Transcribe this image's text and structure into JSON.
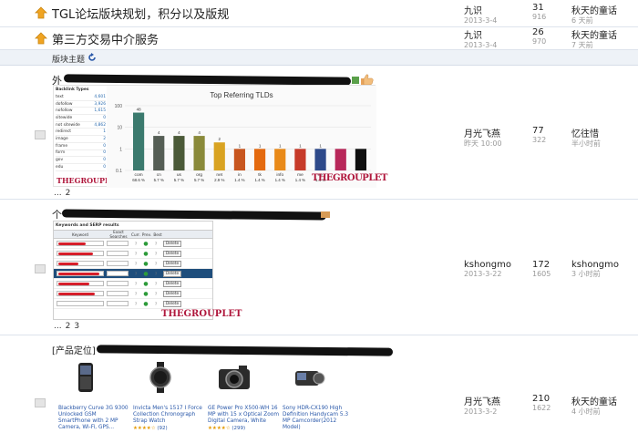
{
  "pinned": [
    {
      "title": "TGL论坛版块规划，积分以及版规",
      "author": "九识",
      "date": "2013-3-4",
      "replies": "31",
      "views": "916",
      "last_user": "秋天的童话",
      "last_time": "6 天前"
    },
    {
      "title": "第三方交易中介服务",
      "author": "九识",
      "date": "2013-3-4",
      "replies": "26",
      "views": "970",
      "last_user": "秋天的童话",
      "last_time": "7 天前"
    }
  ],
  "section": {
    "label": "版块主题"
  },
  "threads": [
    {
      "title_prefix": "外",
      "author": "月光飞燕",
      "date": "昨天 10:00",
      "replies": "77",
      "views": "322",
      "last_user": "忆往惜",
      "last_time": "半小时前",
      "pages": [
        "...",
        "2"
      ]
    },
    {
      "title_prefix": "个",
      "author": "kshongmo",
      "date": "2013-3-22",
      "replies": "172",
      "views": "1605",
      "last_user": "kshongmo",
      "last_time": "3 小时前",
      "pages": [
        "...",
        "2",
        "3"
      ]
    },
    {
      "title_prefix": "[产品定位]",
      "author": "月光飞燕",
      "date": "2013-3-2",
      "replies": "210",
      "views": "1622",
      "last_user": "秋天的童话",
      "last_time": "4 小时前"
    }
  ],
  "backlink_types": {
    "title": "Backlink Types",
    "rows": [
      {
        "label": "text",
        "value": "4,601"
      },
      {
        "label": "dofollow",
        "value": "3,926"
      },
      {
        "label": "nofollow",
        "value": "1,615"
      },
      {
        "label": "sitewide",
        "value": "0"
      },
      {
        "label": "not sitewide",
        "value": "4,862"
      },
      {
        "label": "redirect",
        "value": "1"
      },
      {
        "label": "image",
        "value": "2"
      },
      {
        "label": "frame",
        "value": "0"
      },
      {
        "label": "form",
        "value": "0"
      },
      {
        "label": "gov",
        "value": "0"
      },
      {
        "label": "edu",
        "value": "0"
      }
    ]
  },
  "chart_data": {
    "type": "bar",
    "title": "Top Referring TLDs",
    "categories": [
      "com",
      "cn",
      "us",
      "org",
      "net",
      "in",
      "tk",
      "info",
      "me",
      "se"
    ],
    "values": [
      48,
      4,
      4,
      4,
      2,
      1,
      1,
      1,
      1,
      1
    ],
    "percent_labels": [
      "68.6 %",
      "5.7 %",
      "5.7 %",
      "5.7 %",
      "2.9 %",
      "1.4 %",
      "1.4 %",
      "1.4 %",
      "1.4 %",
      "1.4 %"
    ],
    "colors": [
      "#3b7a6e",
      "#555e55",
      "#4b5a38",
      "#8a8a3a",
      "#d9a321",
      "#c8561f",
      "#e46a0f",
      "#e98a19",
      "#c73b2a",
      "#2e4a8a"
    ],
    "extra_bars": [
      {
        "value": 1,
        "color": "#b8285a"
      },
      {
        "value": 1,
        "color": "#101010"
      }
    ],
    "y_ticks": [
      "100",
      "10",
      "1",
      "0.1"
    ],
    "ylim": [
      0.1,
      100
    ],
    "yscale": "log"
  },
  "logo": {
    "text": "THEGROUPLET"
  },
  "keyword_card": {
    "title": "Keywords and SERP results",
    "headers": [
      "Keyword",
      "Exact Searches",
      "Curr.",
      "Prev.",
      "Best"
    ],
    "delete_label": "Delete",
    "rows": [
      {
        "selected": false,
        "red_w": 30
      },
      {
        "selected": false,
        "red_w": 38
      },
      {
        "selected": false,
        "red_w": 22
      },
      {
        "selected": true,
        "red_w": 45
      },
      {
        "selected": false,
        "red_w": 34
      },
      {
        "selected": false,
        "red_w": 40
      },
      {
        "selected": false,
        "red_w": 0
      }
    ]
  },
  "products": [
    {
      "name": "Blackberry Curve 3G 9300 Unlocked GSM SmartPhone with 2 MP Camera, Wi-Fi, GPS...",
      "stars": "★★★★☆",
      "count": ""
    },
    {
      "name": "Invicta Men's 1517 I Force Collection Chronograph Strap Watch",
      "stars": "★★★★☆",
      "count": "(92)"
    },
    {
      "name": "GE Power Pro X500-WH 16 MP with 15 x Optical Zoom Digital Camera, White",
      "stars": "★★★★☆",
      "count": "(299)"
    },
    {
      "name": "Sony HDR-CX190 High Definition Handycam 5.3 MP Camcorder(2012 Model)",
      "stars": "",
      "count": ""
    }
  ],
  "colors": {
    "accent": "#2756a8",
    "pin": "#f0a422",
    "brand_red": "#b0183d"
  }
}
